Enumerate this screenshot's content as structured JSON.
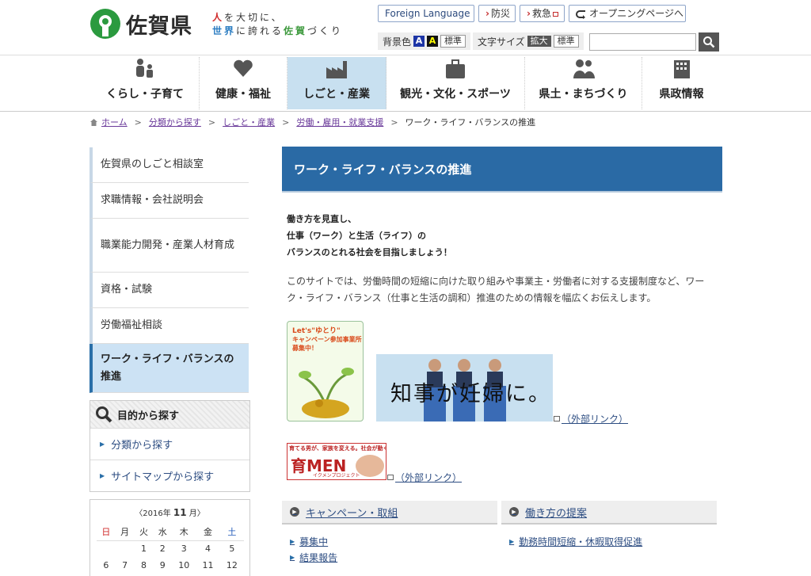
{
  "header": {
    "site_name": "佐賀県",
    "tagline_line1_a": "人",
    "tagline_line1_b": "を大切に、",
    "tagline_line2_a": "世界",
    "tagline_line2_b": "に誇れる",
    "tagline_line2_c": "佐賀",
    "tagline_line2_d": "づくり",
    "foreign_language": "Foreign Language",
    "bousai": "防災",
    "kyukyu": "救急",
    "opening": "オープニングページへ",
    "bgcolor_label": "背景色",
    "bgcolor_blue": "A",
    "bgcolor_black": "A",
    "bgcolor_standard": "標準",
    "fontsize_label": "文字サイズ",
    "fontsize_large": "拡大",
    "fontsize_standard": "標準",
    "search_value": ""
  },
  "gnav": [
    {
      "label": "くらし・子育て",
      "icon": "family-icon"
    },
    {
      "label": "健康・福祉",
      "icon": "heart-hands-icon"
    },
    {
      "label": "しごと・産業",
      "icon": "factory-icon"
    },
    {
      "label": "観光・文化・スポーツ",
      "icon": "suitcase-icon"
    },
    {
      "label": "県土・まちづくり",
      "icon": "people-icon"
    },
    {
      "label": "県政情報",
      "icon": "building-icon"
    }
  ],
  "breadcrumb": {
    "home": "ホーム",
    "c1": "分類から探す",
    "c2": "しごと・産業",
    "c3": "労働・雇用・就業支援",
    "current": "ワーク・ライフ・バランスの推進"
  },
  "sidemenu": [
    {
      "label": "佐賀県のしごと相談室"
    },
    {
      "label": "求職情報・会社説明会"
    },
    {
      "label": "職業能力開発・産業人材育成"
    },
    {
      "label": "資格・試験"
    },
    {
      "label": "労働福祉相談"
    },
    {
      "label": "ワーク・ライフ・バランスの推進"
    }
  ],
  "purpose": {
    "title": "目的から探す",
    "items": [
      "分類から探す",
      "サイトマップから探す"
    ]
  },
  "calendar": {
    "prev": "〈",
    "year": "2016",
    "year_suffix": "年",
    "month": "11",
    "month_suffix": "月",
    "next": "〉",
    "weekdays": [
      "日",
      "月",
      "火",
      "水",
      "木",
      "金",
      "土"
    ],
    "row1": [
      "",
      "",
      "1",
      "2",
      "3",
      "4",
      "5"
    ],
    "row2": [
      "6",
      "7",
      "8",
      "9",
      "10",
      "11",
      "12"
    ]
  },
  "main": {
    "title": "ワーク・ライフ・バランスの推進",
    "lead1": "働き方を見直し、",
    "lead2": "仕事（ワーク）と生活（ライフ）の",
    "lead3": "バランスのとれる社会を目指しましょう！",
    "desc": "このサイトでは、労働時間の短縮に向けた取り組みや事業主・労働者に対する支援制度など、ワーク・ライフ・バランス（仕事と生活の調和）推進のための情報を幅広くお伝えします。",
    "banner1_line1": "Let's\"ゆとり\"",
    "banner1_line2": "キャンペーン参加事業所募集中！",
    "banner2_text": "知事が妊婦に。",
    "banner3_top": "育てる男が、家族を変える。社会が動く。",
    "banner3_main": "育MEN",
    "banner3_sub": "イクメンプロジェクト",
    "ext_link": "（外部リンク）"
  },
  "boxes": [
    {
      "title": "キャンペーン・取組",
      "items": [
        "募集中",
        "結果報告"
      ]
    },
    {
      "title": "働き方の提案",
      "items": [
        "勤務時間短縮・休暇取得促進"
      ]
    }
  ],
  "colors": {
    "accent": "#2a6aa5",
    "active_nav": "#c8e0f0",
    "link": "#2d4d82"
  }
}
